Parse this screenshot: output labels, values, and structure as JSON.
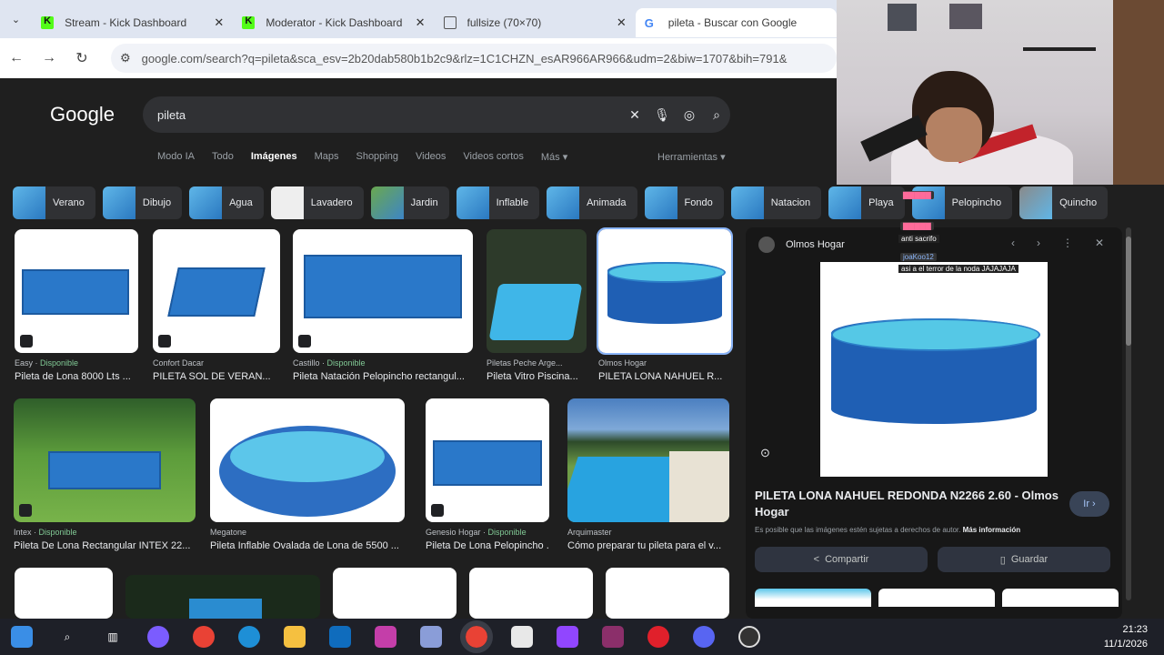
{
  "browser": {
    "tabs": [
      {
        "title": "Stream - Kick Dashboard",
        "icon": "kick-icon"
      },
      {
        "title": "Moderator - Kick Dashboard",
        "icon": "kick-icon"
      },
      {
        "title": "fullsize (70×70)",
        "icon": "globe-icon"
      },
      {
        "title": "pileta - Buscar con Google",
        "icon": "google-icon",
        "active": true
      }
    ],
    "url": "google.com/search?q=pileta&sca_esv=2b20dab580b1b2c9&rlz=1C1CHZN_esAR966AR966&udm=2&biw=1707&bih=791&"
  },
  "google": {
    "logo": "Google",
    "query": "pileta",
    "tabs": [
      "Modo IA",
      "Todo",
      "Imágenes",
      "Maps",
      "Shopping",
      "Videos",
      "Videos cortos",
      "Más ▾"
    ],
    "active_tab": "Imágenes",
    "tools": "Herramientas ▾",
    "chips": [
      "Verano",
      "Dibujo",
      "Agua",
      "Lavadero",
      "Jardin",
      "Inflable",
      "Animada",
      "Fondo",
      "Natacion",
      "Playa",
      "Pelopincho",
      "Quincho"
    ]
  },
  "results": [
    {
      "source": "Easy",
      "avail": "Disponible",
      "caption": "Pileta de Lona 8000 Lts ..."
    },
    {
      "source": "Confort Dacar",
      "avail": "",
      "caption": "PILETA SOL DE VERAN..."
    },
    {
      "source": "Castillo",
      "avail": "Disponible",
      "caption": "Pileta Natación Pelopincho rectangul..."
    },
    {
      "source": "Piletas Peche Arge...",
      "avail": "",
      "caption": "Pileta Vitro Piscina..."
    },
    {
      "source": "Olmos Hogar",
      "avail": "",
      "caption": "PILETA LONA NAHUEL R..."
    },
    {
      "source": "Intex",
      "avail": "Disponible",
      "caption": "Pileta De Lona Rectangular INTEX 22..."
    },
    {
      "source": "Megatone",
      "avail": "",
      "caption": "Pileta Inflable Ovalada de Lona de 5500 ..."
    },
    {
      "source": "Genesio Hogar",
      "avail": "Disponible",
      "caption": "Pileta De Lona Pelopincho ..."
    },
    {
      "source": "Arquimaster",
      "avail": "",
      "caption": "Cómo preparar tu pileta para el v..."
    }
  ],
  "panel": {
    "source": "Olmos Hogar",
    "title": "PILETA LONA NAHUEL REDONDA N2266 2.60 - Olmos Hogar",
    "visit": "Ir ›",
    "note": "Es posible que las imágenes estén sujetas a derechos de autor.",
    "more_info": "Más información",
    "share": "Compartir",
    "save": "Guardar"
  },
  "chat": {
    "line1_msg": "anti sacrifo",
    "line2_name": "joaKoo12",
    "line2_msg": "asi a el terror de la noda JAJAJAJA"
  },
  "taskbar": {
    "time": "21:23",
    "date": "11/1/2026"
  }
}
